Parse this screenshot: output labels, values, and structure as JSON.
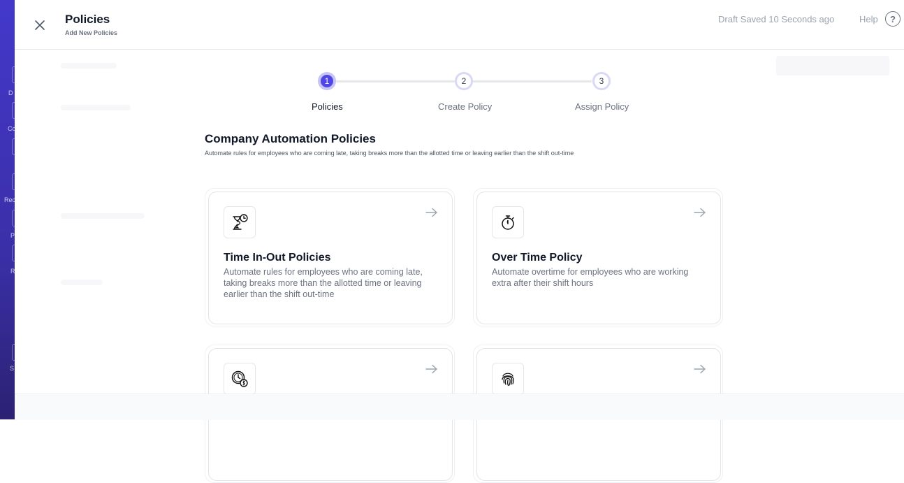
{
  "background_nav": {
    "fragments": [
      "D",
      "Co",
      "Rec",
      "P",
      "R",
      "S"
    ]
  },
  "header": {
    "title": "Policies",
    "subtitle": "Add New Policies",
    "draft_status": "Draft Saved 10 Seconds ago",
    "help_label": "Help",
    "help_symbol": "?"
  },
  "stepper": {
    "steps": [
      {
        "number": "1",
        "label": "Policies",
        "state": "active"
      },
      {
        "number": "2",
        "label": "Create Policy",
        "state": "upcoming"
      },
      {
        "number": "3",
        "label": "Assign Policy",
        "state": "upcoming"
      }
    ]
  },
  "section": {
    "title": "Company Automation Policies",
    "description": "Automate rules for employees who are coming late, taking breaks more than the allotted time or leaving earlier than the shift out-time"
  },
  "cards": [
    {
      "icon": "hourglass-clock-icon",
      "title": "Time In-Out Policies",
      "description": "Automate rules for employees who are coming late, taking breaks more than the allotted time or leaving earlier than the shift out-time"
    },
    {
      "icon": "stopwatch-icon",
      "title": "Over Time Policy",
      "description": "Automate overtime for employees who are working extra after their shift hours"
    },
    {
      "icon": "clock-money-icon",
      "title": "",
      "description": ""
    },
    {
      "icon": "fingerprint-icon",
      "title": "",
      "description": ""
    }
  ],
  "colors": {
    "accent": "#4f46e5",
    "nav_strip": "#4338ca",
    "text_primary": "#111827",
    "text_muted": "#6b7280"
  }
}
